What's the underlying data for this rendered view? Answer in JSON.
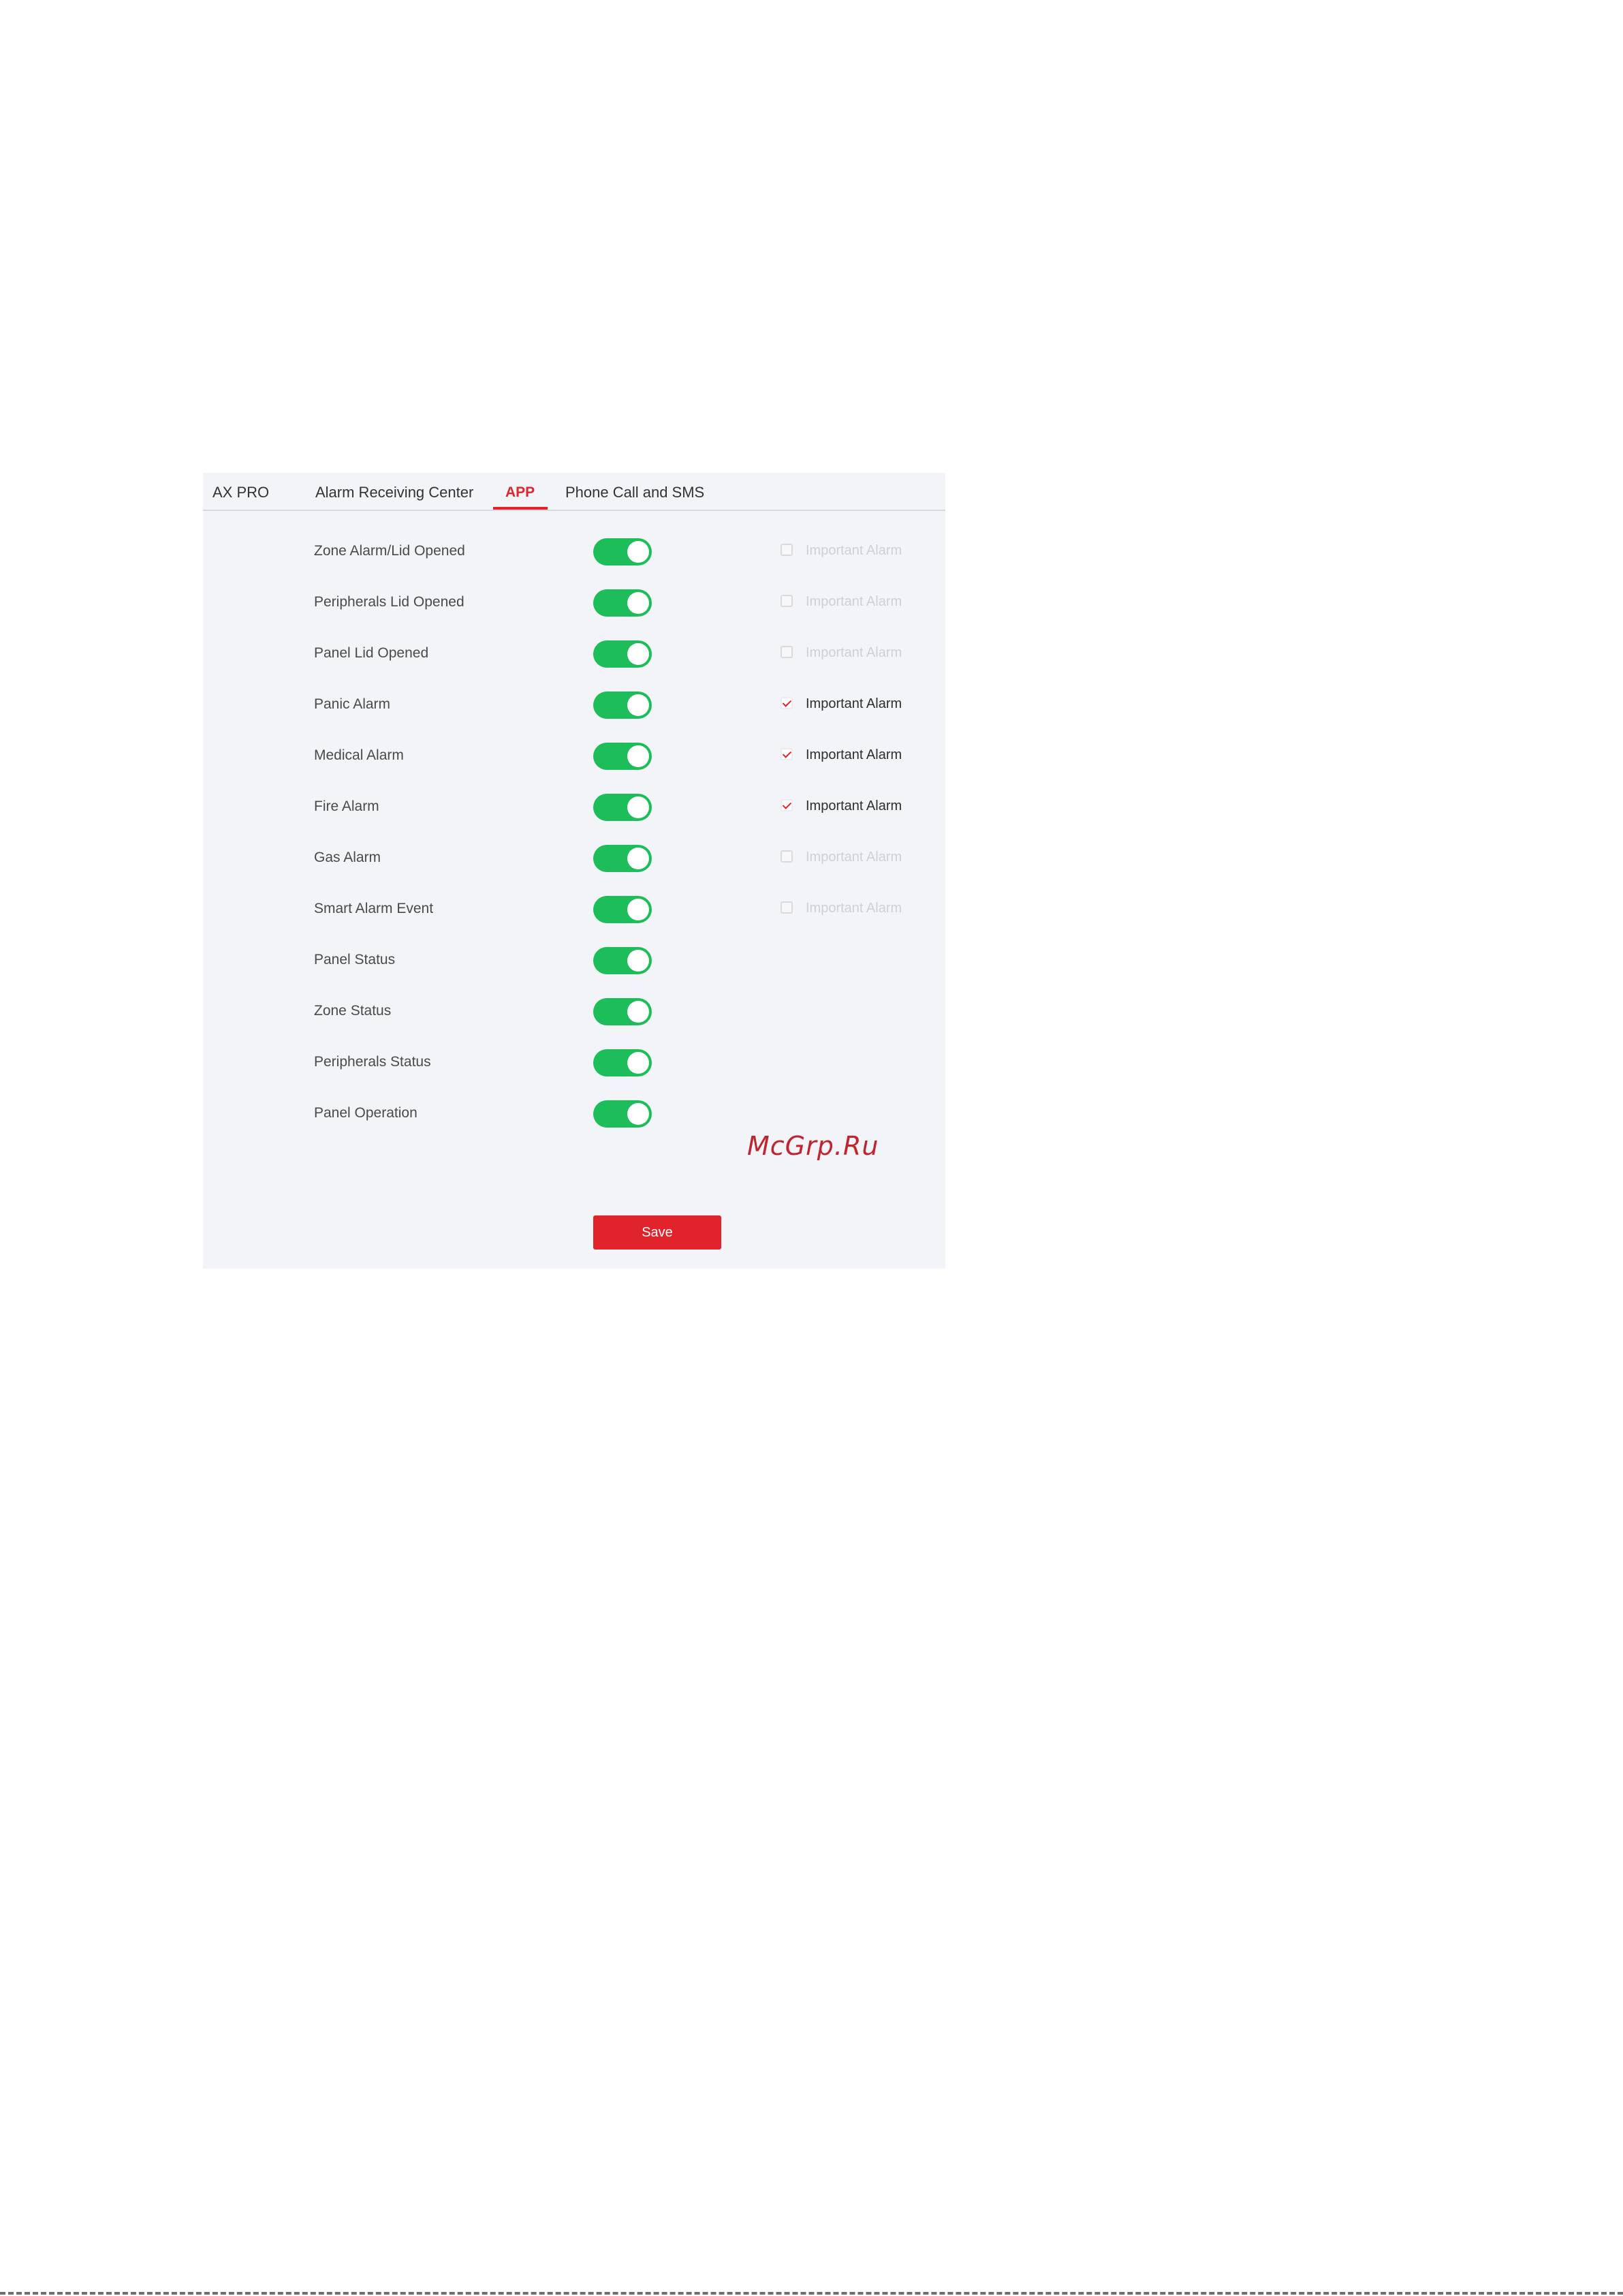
{
  "tabs": [
    {
      "label": "AX PRO",
      "active": false
    },
    {
      "label": "Alarm Receiving Center",
      "active": false
    },
    {
      "label": "APP",
      "active": true
    },
    {
      "label": "Phone Call and SMS",
      "active": false
    }
  ],
  "rows": [
    {
      "label": "Zone Alarm/Lid Opened",
      "enabled": true,
      "important_label": "Important Alarm",
      "important": false
    },
    {
      "label": "Peripherals Lid Opened",
      "enabled": true,
      "important_label": "Important Alarm",
      "important": false
    },
    {
      "label": "Panel Lid Opened",
      "enabled": true,
      "important_label": "Important Alarm",
      "important": false
    },
    {
      "label": "Panic Alarm",
      "enabled": true,
      "important_label": "Important Alarm",
      "important": true
    },
    {
      "label": "Medical Alarm",
      "enabled": true,
      "important_label": "Important Alarm",
      "important": true
    },
    {
      "label": "Fire Alarm",
      "enabled": true,
      "important_label": "Important Alarm",
      "important": true
    },
    {
      "label": "Gas Alarm",
      "enabled": true,
      "important_label": "Important Alarm",
      "important": false
    },
    {
      "label": "Smart Alarm Event",
      "enabled": true,
      "important_label": "Important Alarm",
      "important": false
    },
    {
      "label": "Panel Status",
      "enabled": true
    },
    {
      "label": "Zone Status",
      "enabled": true
    },
    {
      "label": "Peripherals Status",
      "enabled": true
    },
    {
      "label": "Panel Operation",
      "enabled": true
    }
  ],
  "save_label": "Save",
  "watermark": "McGrp.Ru",
  "colors": {
    "accent": "#e1242c",
    "toggle_on": "#1dbe5a",
    "panel_bg": "#f3f4f8"
  }
}
